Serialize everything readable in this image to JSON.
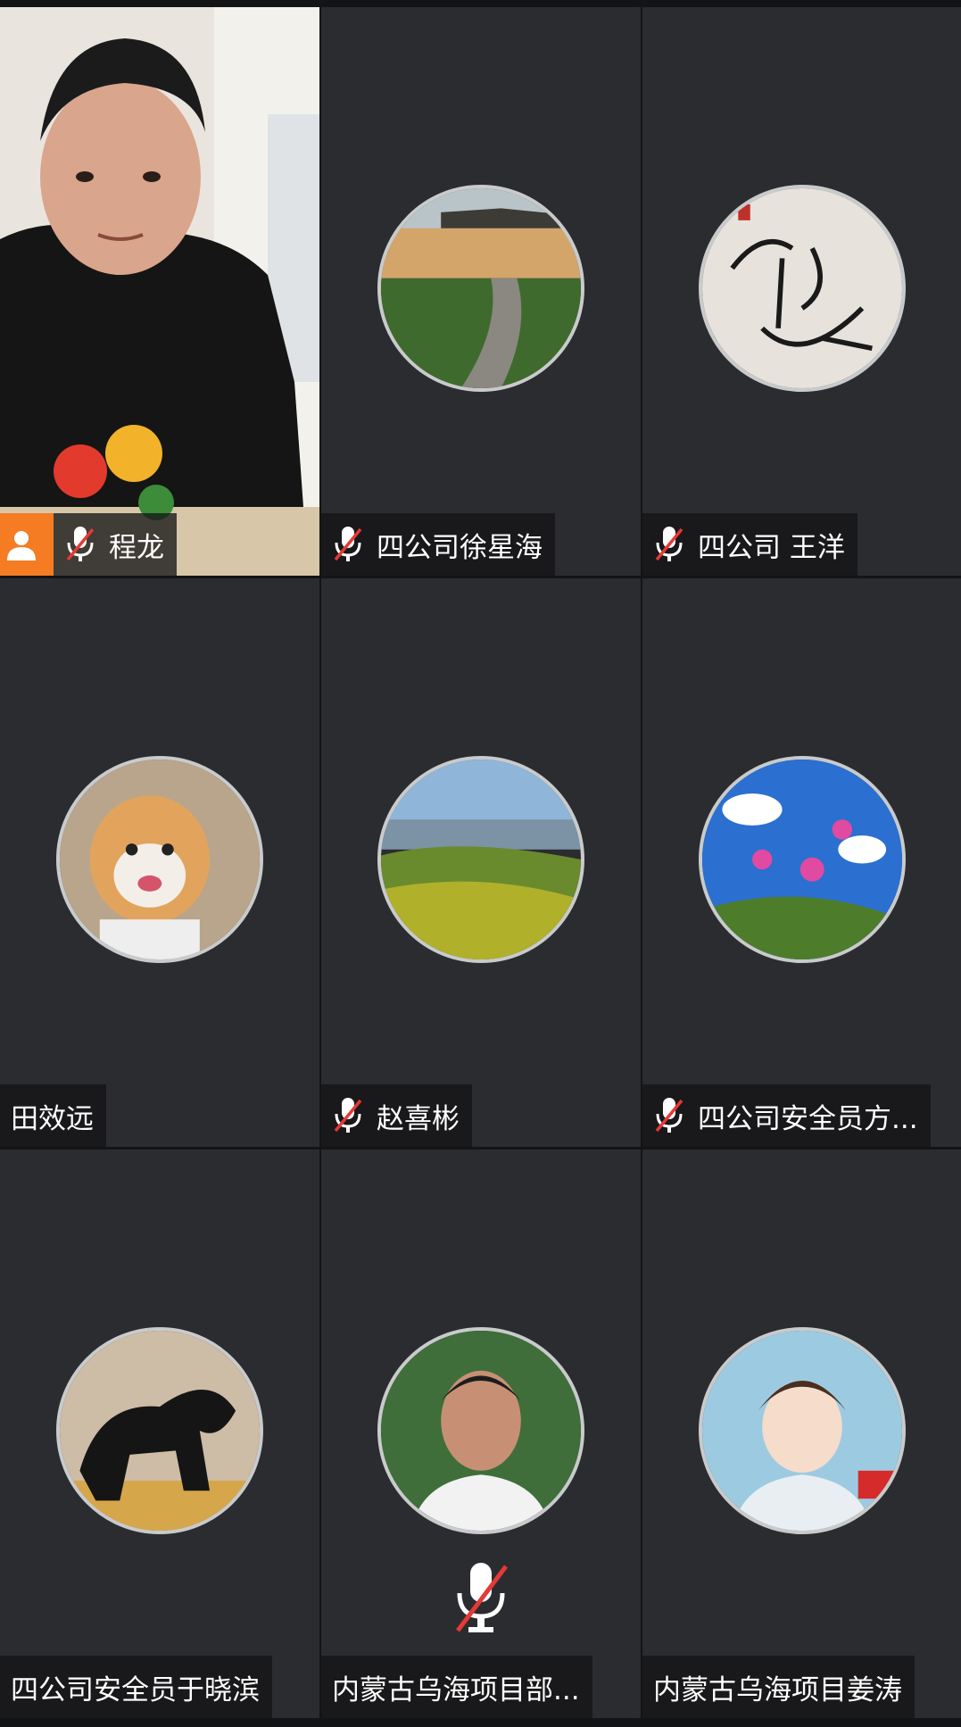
{
  "participants": [
    {
      "name": "程龙",
      "muted": true,
      "video": true,
      "avatar": "video-feed-man"
    },
    {
      "name": "四公司徐星海",
      "muted": true,
      "avatar": "beach-boardwalk"
    },
    {
      "name": "四公司 王洋",
      "muted": true,
      "avatar": "calligraphy"
    },
    {
      "name": "田效远",
      "muted": false,
      "avatar": "shiba-dog"
    },
    {
      "name": "赵喜彬",
      "muted": true,
      "avatar": "green-hills"
    },
    {
      "name": "四公司安全员方...",
      "muted": true,
      "avatar": "pink-flowers-sky"
    },
    {
      "name": "四公司安全员于晓滨",
      "muted": false,
      "avatar": "black-horse"
    },
    {
      "name": "内蒙古乌海项目部...",
      "muted": false,
      "avatar": "man-portrait"
    },
    {
      "name": "内蒙古乌海项目姜涛",
      "muted": false,
      "avatar": "cartoon-man"
    }
  ],
  "colors": {
    "tile": "#2b2c2f",
    "accent": "#f57c22",
    "mute_slash": "#e53935"
  }
}
